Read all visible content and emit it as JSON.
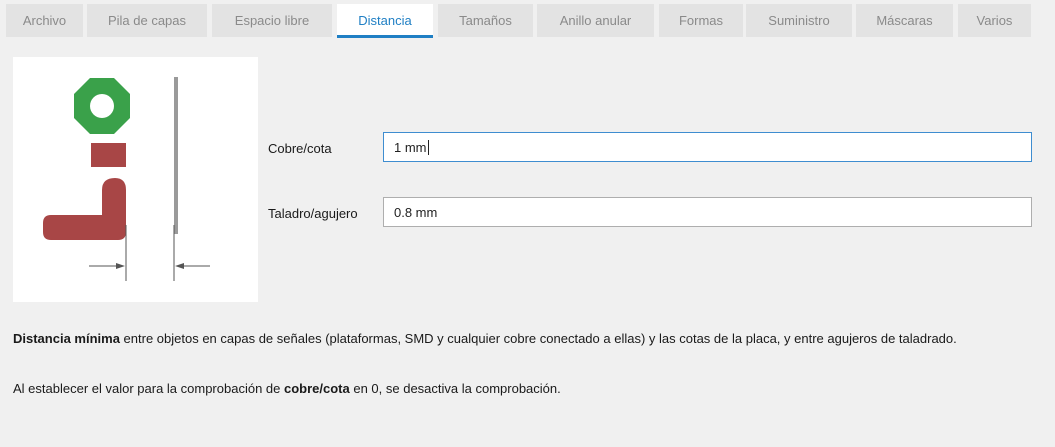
{
  "tabs": [
    {
      "label": "Archivo",
      "active": false
    },
    {
      "label": "Pila de capas",
      "active": false
    },
    {
      "label": "Espacio libre",
      "active": false
    },
    {
      "label": "Distancia",
      "active": true
    },
    {
      "label": "Tamaños",
      "active": false
    },
    {
      "label": "Anillo anular",
      "active": false
    },
    {
      "label": "Formas",
      "active": false
    },
    {
      "label": "Suministro",
      "active": false
    },
    {
      "label": "Máscaras",
      "active": false
    },
    {
      "label": "Varios",
      "active": false
    }
  ],
  "fields": {
    "copper_dimension": {
      "label": "Cobre/cota",
      "value": "1 mm"
    },
    "drill_hole": {
      "label": "Taladro/agujero",
      "value": "0.8 mm"
    }
  },
  "description": {
    "p1_bold": "Distancia mínima",
    "p1_rest": " entre objetos en capas de señales (plataformas, SMD y cualquier cobre conectado a ellas) y las cotas de la placa, y entre agujeros de taladrado.",
    "p2_pre": "Al establecer el valor para la comprobación de ",
    "p2_bold": "cobre/cota",
    "p2_post": " en 0, se desactiva la comprobación."
  },
  "colors": {
    "accent": "#1f7fc4",
    "pad_green": "#3aa14a",
    "copper_red": "#a84646",
    "dimension_gray": "#9a9a9a"
  }
}
